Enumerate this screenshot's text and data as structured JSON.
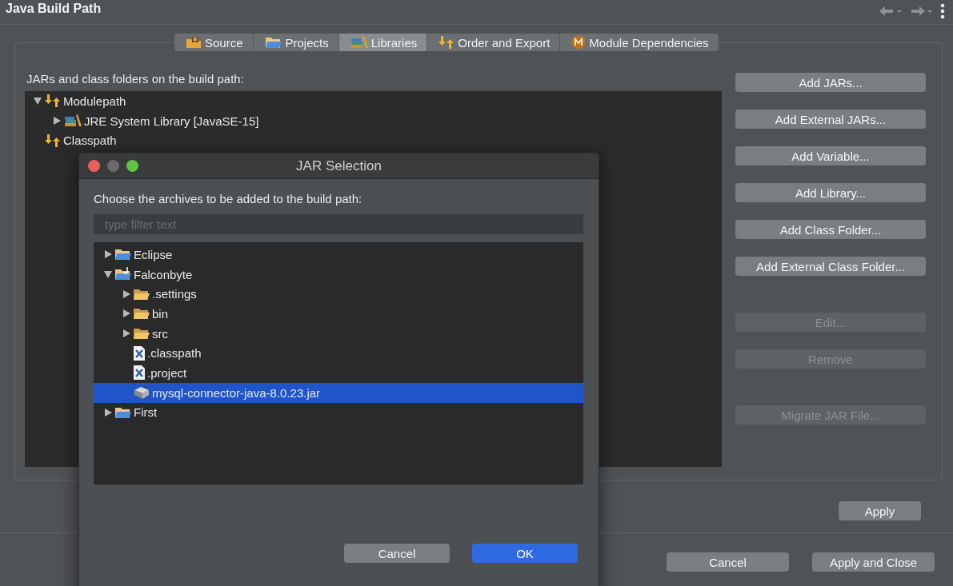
{
  "window": {
    "title": "Java Build Path"
  },
  "tabs": [
    {
      "label": "Source",
      "kind": "source",
      "selected": false
    },
    {
      "label": "Projects",
      "kind": "projects",
      "selected": false
    },
    {
      "label": "Libraries",
      "kind": "libraries",
      "selected": true
    },
    {
      "label": "Order and Export",
      "kind": "order",
      "selected": false
    },
    {
      "label": "Module Dependencies",
      "kind": "module",
      "selected": false
    }
  ],
  "build_path": {
    "label": "JARs and class folders on the build path:",
    "tree": [
      {
        "label": "Modulepath",
        "kind": "path",
        "expanded": true,
        "children": [
          {
            "label": "JRE System Library [JavaSE-15]",
            "kind": "library",
            "expanded": false
          }
        ]
      },
      {
        "label": "Classpath",
        "kind": "path"
      }
    ]
  },
  "buttons": [
    {
      "label": "Add JARs...",
      "disabled": false
    },
    {
      "label": "Add External JARs...",
      "disabled": false
    },
    {
      "label": "Add Variable...",
      "disabled": false
    },
    {
      "label": "Add Library...",
      "disabled": false
    },
    {
      "label": "Add Class Folder...",
      "disabled": false
    },
    {
      "label": "Add External Class Folder...",
      "disabled": false
    },
    {
      "label": "Edit...",
      "disabled": true
    },
    {
      "label": "Remove",
      "disabled": true
    },
    {
      "label": "Migrate JAR File...",
      "disabled": true
    }
  ],
  "apply": "Apply",
  "footer_buttons": [
    {
      "label": "Cancel",
      "default": false
    },
    {
      "label": "Apply and Close",
      "default": false
    }
  ],
  "dialog": {
    "title": "JAR Selection",
    "prompt": "Choose the archives to be added to the build path:",
    "filter": {
      "placeholder": "type filter text"
    },
    "tree": [
      {
        "label": "Eclipse",
        "kind": "project",
        "expanded": false,
        "selected": false
      },
      {
        "label": "Falconbyte",
        "kind": "java-project",
        "expanded": true,
        "selected": false,
        "children": [
          {
            "label": ".settings",
            "kind": "folder",
            "expanded": false,
            "selected": false
          },
          {
            "label": "bin",
            "kind": "folder",
            "expanded": false,
            "selected": false
          },
          {
            "label": "src",
            "kind": "folder",
            "expanded": false,
            "selected": false
          },
          {
            "label": ".classpath",
            "kind": "file",
            "selected": false
          },
          {
            "label": ".project",
            "kind": "file",
            "selected": false
          },
          {
            "label": "mysql-connector-java-8.0.23.jar",
            "kind": "jar",
            "selected": true
          }
        ]
      },
      {
        "label": "First",
        "kind": "project",
        "expanded": false,
        "selected": false
      }
    ],
    "buttons": [
      {
        "label": "Cancel",
        "default": false
      },
      {
        "label": "OK",
        "default": true
      }
    ]
  }
}
